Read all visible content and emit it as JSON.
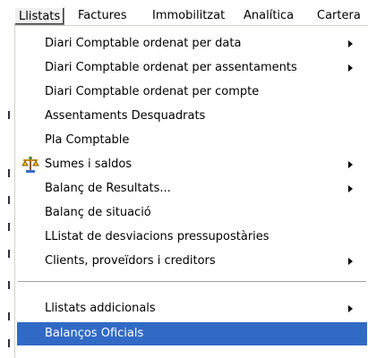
{
  "menubar": {
    "items": [
      {
        "label": "Llistats",
        "active": true
      },
      {
        "label": "Factures"
      },
      {
        "label": "Immobilitzat"
      },
      {
        "label": "Analítica"
      },
      {
        "label": "Cartera"
      }
    ]
  },
  "menu": {
    "items": [
      {
        "label": "Diari Comptable ordenat per data",
        "submenu": true
      },
      {
        "label": "Diari Comptable ordenat per assentaments",
        "submenu": true
      },
      {
        "label": "Diari Comptable ordenat per compte",
        "submenu": false
      },
      {
        "label": "Assentaments Desquadrats",
        "submenu": false
      },
      {
        "label": "Pla Comptable",
        "submenu": false
      },
      {
        "label": "Sumes i saldos",
        "submenu": true,
        "icon": "scales-icon"
      },
      {
        "label": "Balanç de Resultats...",
        "submenu": true
      },
      {
        "label": "Balanç de situació",
        "submenu": false
      },
      {
        "label": "LListat de desviacions pressupostàries",
        "submenu": false
      },
      {
        "label": "Clients, proveïdors i creditors",
        "submenu": true
      },
      {
        "label": "Llistats addicionals",
        "submenu": true
      },
      {
        "label": "Balanços Oficials",
        "submenu": false,
        "selected": true
      }
    ]
  },
  "colors": {
    "selection": "#316ac5",
    "menu_bg": "#ffffff",
    "separator": "#a0a0a0"
  }
}
